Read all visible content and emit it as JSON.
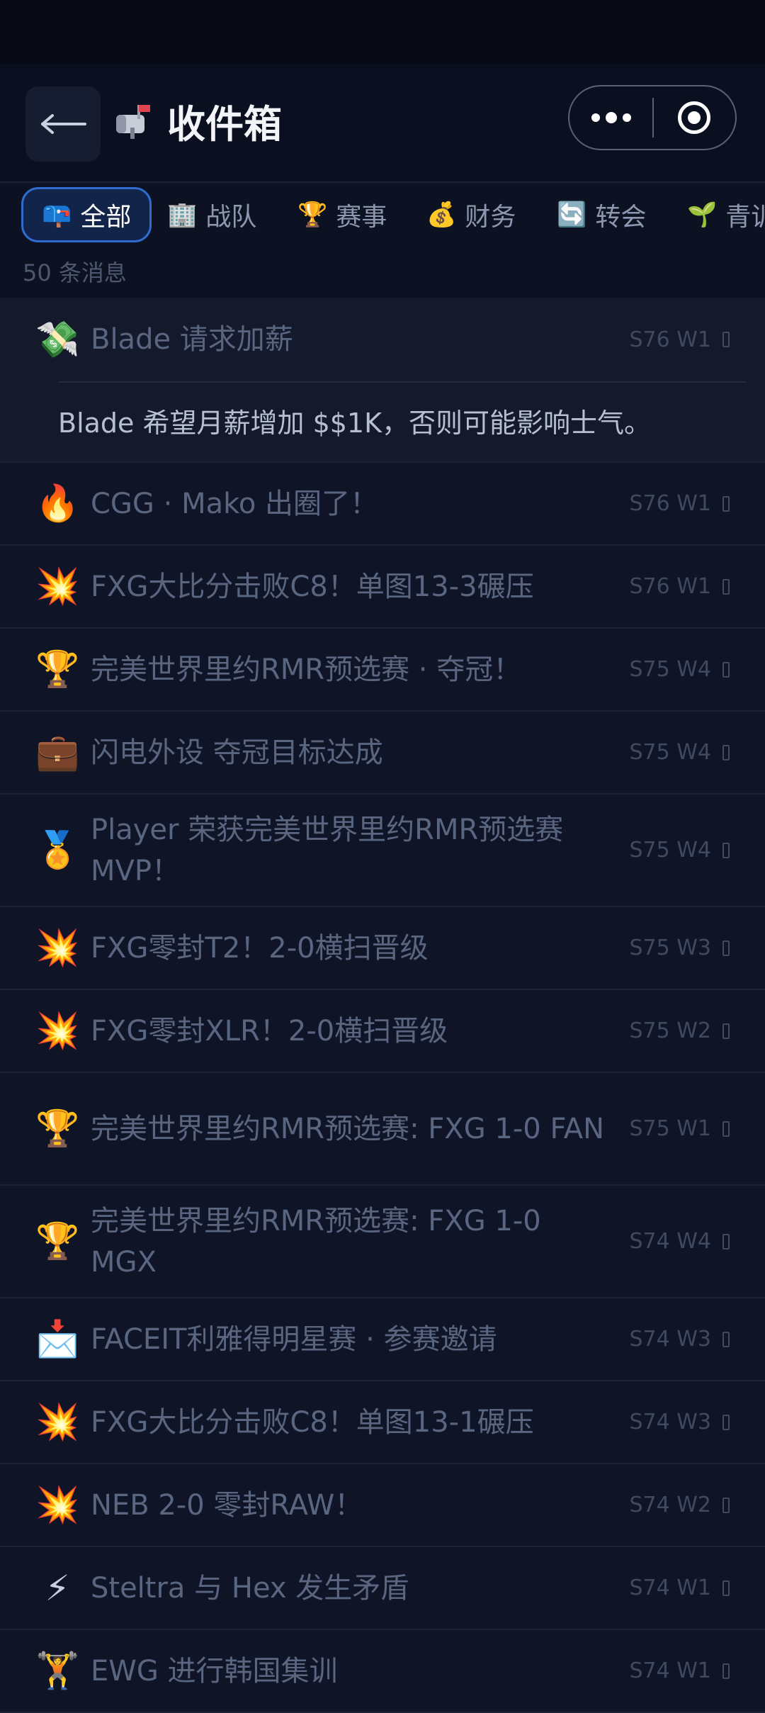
{
  "header": {
    "title": "收件箱",
    "title_icon": "mailbox-icon"
  },
  "tabs": [
    {
      "emoji": "📪",
      "label": "全部",
      "active": true
    },
    {
      "emoji": "🏢",
      "label": "战队"
    },
    {
      "emoji": "🏆",
      "label": "赛事"
    },
    {
      "emoji": "💰",
      "label": "财务"
    },
    {
      "emoji": "🔄",
      "label": "转会"
    },
    {
      "emoji": "🌱",
      "label": "青训"
    }
  ],
  "count_text": "50 条消息",
  "messages": [
    {
      "icon": "💸",
      "text": "Blade 请求加薪",
      "meta": "S76 W1",
      "detail": "Blade 希望月薪增加 $$1K，否则可能影响士气。"
    },
    {
      "icon": "🔥",
      "text": "CGG · Mako 出圈了！",
      "meta": "S76 W1"
    },
    {
      "icon": "💥",
      "text": "FXG大比分击败C8！单图13-3碾压",
      "meta": "S76 W1"
    },
    {
      "icon": "🏆",
      "text": "完美世界里约RMR预选赛 · 夺冠！",
      "meta": "S75 W4"
    },
    {
      "icon": "💼",
      "text": "闪电外设 夺冠目标达成",
      "meta": "S75 W4"
    },
    {
      "icon": "🏅",
      "text": "Player 荣获完美世界里约RMR预选赛 MVP！",
      "meta": "S75 W4"
    },
    {
      "icon": "💥",
      "text": "FXG零封T2！2-0横扫晋级",
      "meta": "S75 W3"
    },
    {
      "icon": "💥",
      "text": "FXG零封XLR！2-0横扫晋级",
      "meta": "S75 W2"
    },
    {
      "icon": "🏆",
      "text": "完美世界里约RMR预选赛: FXG 1-0 FAN",
      "meta": "S75 W1"
    },
    {
      "icon": "🏆",
      "text": "完美世界里约RMR预选赛: FXG 1-0 MGX",
      "meta": "S74 W4"
    },
    {
      "icon": "📩",
      "text": "FACEIT利雅得明星赛 · 参赛邀请",
      "meta": "S74 W3"
    },
    {
      "icon": "💥",
      "text": "FXG大比分击败C8！单图13-1碾压",
      "meta": "S74 W3"
    },
    {
      "icon": "💥",
      "text": "NEB 2-0 零封RAW！",
      "meta": "S74 W2"
    },
    {
      "icon": "⚡",
      "text": "Steltra 与 Hex 发生矛盾",
      "meta": "S74 W1"
    },
    {
      "icon": "🏋",
      "text": "EWG 进行韩国集训",
      "meta": "S74 W1"
    }
  ]
}
